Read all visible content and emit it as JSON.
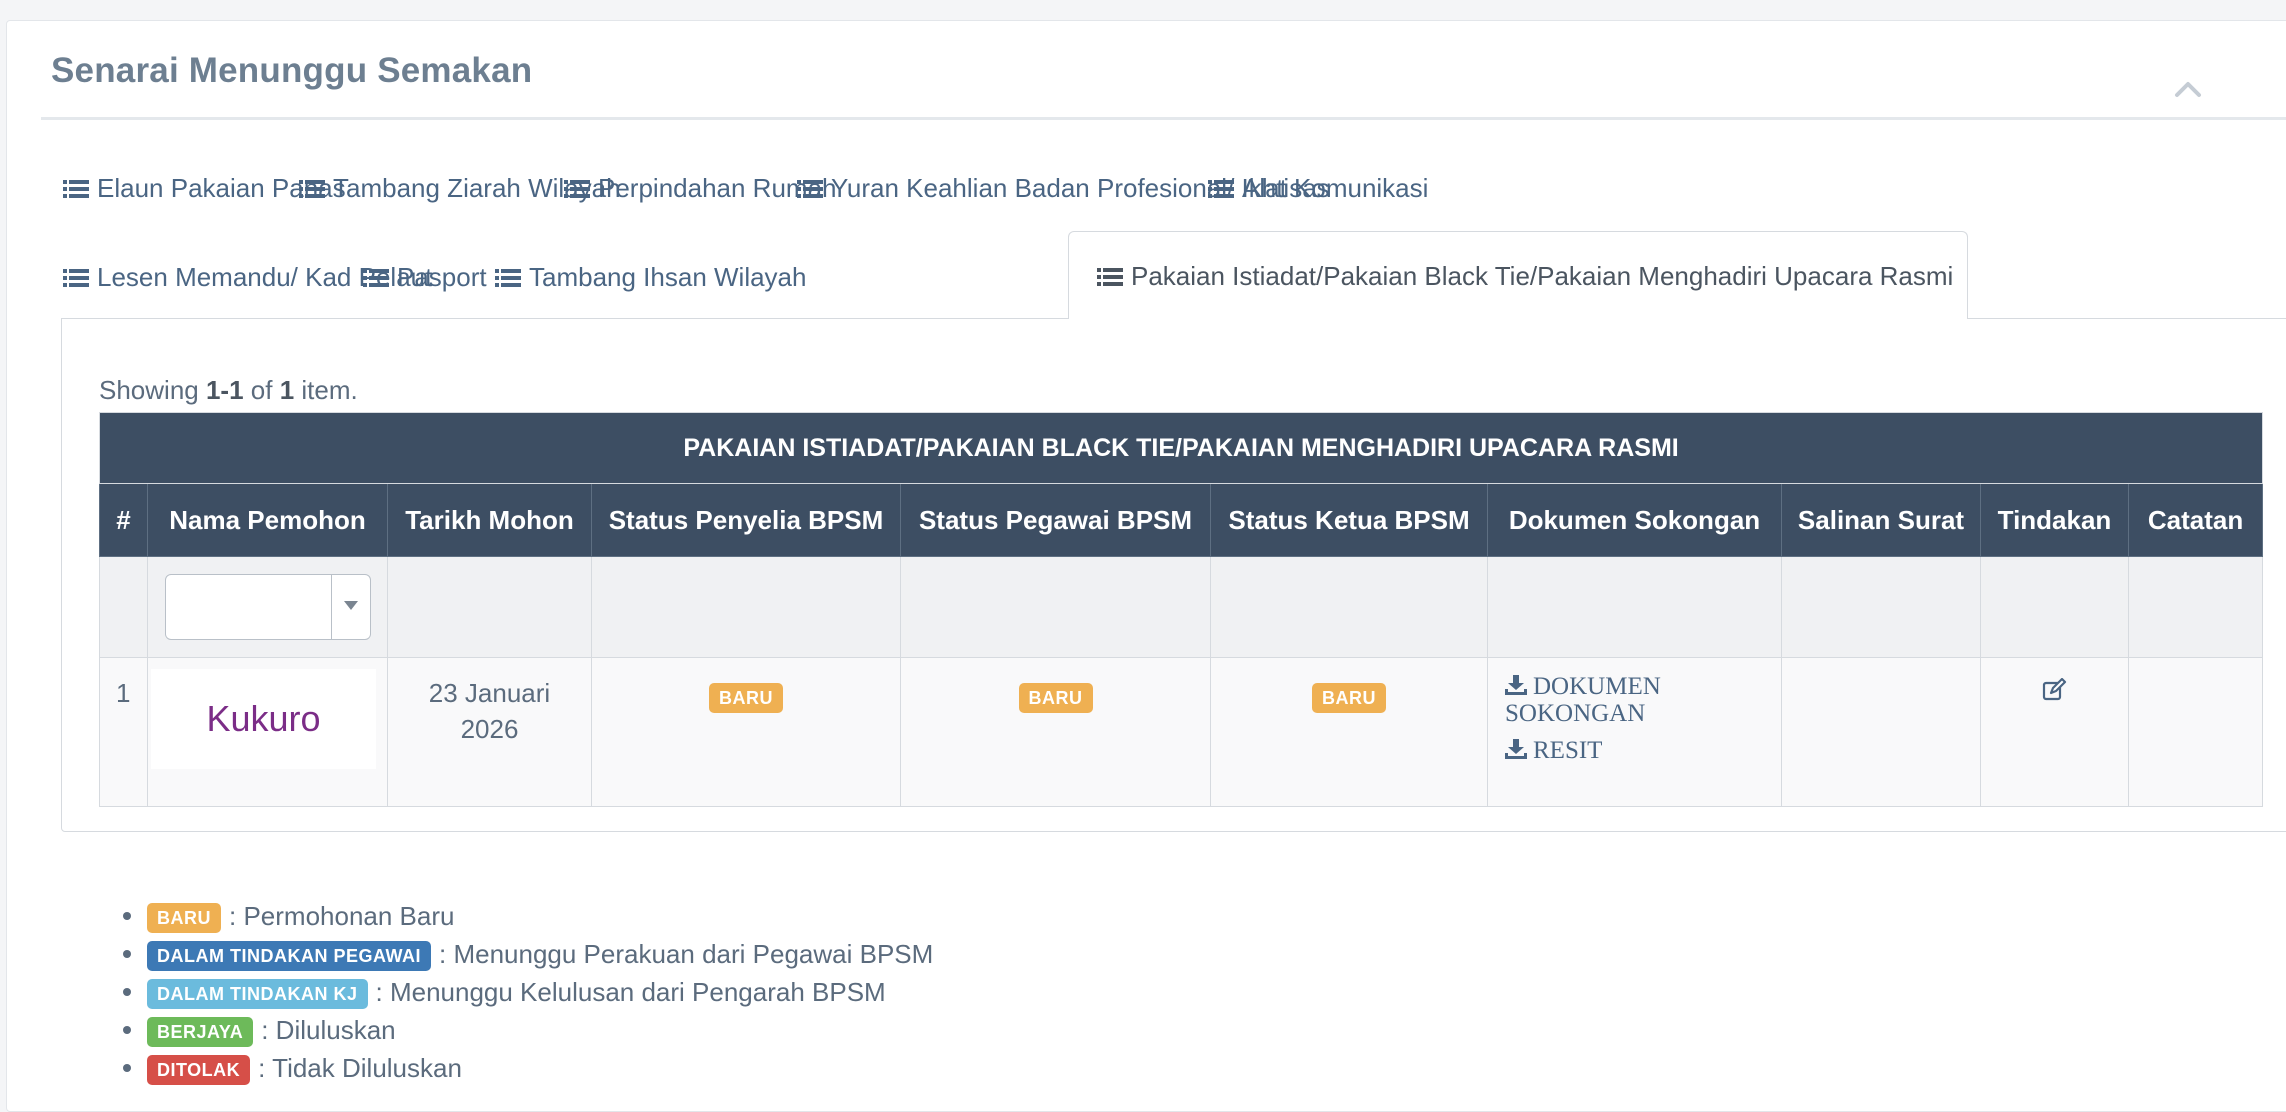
{
  "panel": {
    "title": "Senarai Menunggu Semakan"
  },
  "tabs": [
    {
      "label": "Elaun Pakaian Panas"
    },
    {
      "label": "Tambang Ziarah Wilayah"
    },
    {
      "label": "Perpindahan Rumah"
    },
    {
      "label": "Yuran Keahlian Badan Profesional/ Ikhtisas"
    },
    {
      "label": "Alat Komunikasi"
    },
    {
      "label": "Lesen Memandu/ Kad Pelaut"
    },
    {
      "label": "Pasport"
    },
    {
      "label": "Tambang Ihsan Wilayah"
    },
    {
      "label": "Pakaian Istiadat/Pakaian Black Tie/Pakaian Menghadiri Upacara Rasmi",
      "active": true
    }
  ],
  "summary": {
    "prefix": "Showing ",
    "range": "1-1",
    "mid": " of ",
    "total": "1",
    "suffix": " item."
  },
  "table": {
    "caption": "PAKAIAN ISTIADAT/PAKAIAN BLACK TIE/PAKAIAN MENGHADIRI UPACARA RASMI",
    "columns": [
      "#",
      "Nama Pemohon",
      "Tarikh Mohon",
      "Status Penyelia BPSM",
      "Status Pegawai BPSM",
      "Status Ketua BPSM",
      "Dokumen Sokongan",
      "Salinan Surat",
      "Tindakan",
      "Catatan"
    ],
    "filter": {
      "name_select_value": ""
    },
    "rows": [
      {
        "index": "1",
        "name": "Kukuro",
        "date_line1": "23 Januari",
        "date_line2": "2026",
        "status_penyelia": "BARU",
        "status_pegawai": "BARU",
        "status_ketua": "BARU",
        "doc_link_1": "DOKUMEN SOKONGAN",
        "doc_link_2": "RESIT",
        "salinan_surat": "",
        "catatan": ""
      }
    ]
  },
  "legend": [
    {
      "badge": "BARU",
      "desc": ": Permohonan Baru",
      "color": "#efb052"
    },
    {
      "badge": "DALAM TINDAKAN PEGAWAI",
      "desc": ": Menunggu Perakuan dari Pegawai BPSM",
      "color": "#3d79b5"
    },
    {
      "badge": "DALAM TINDAKAN KJ",
      "desc": ": Menunggu Kelulusan dari Pengarah BPSM",
      "color": "#6bbbdd"
    },
    {
      "badge": "BERJAYA",
      "desc": ": Diluluskan",
      "color": "#6dba5a"
    },
    {
      "badge": "DITOLAK",
      "desc": ": Tidak Diluluskan",
      "color": "#d64f48"
    }
  ],
  "icons": {
    "tab": "list-icon",
    "collapse": "chevron-up-icon",
    "download": "download-icon",
    "edit": "edit-icon"
  }
}
